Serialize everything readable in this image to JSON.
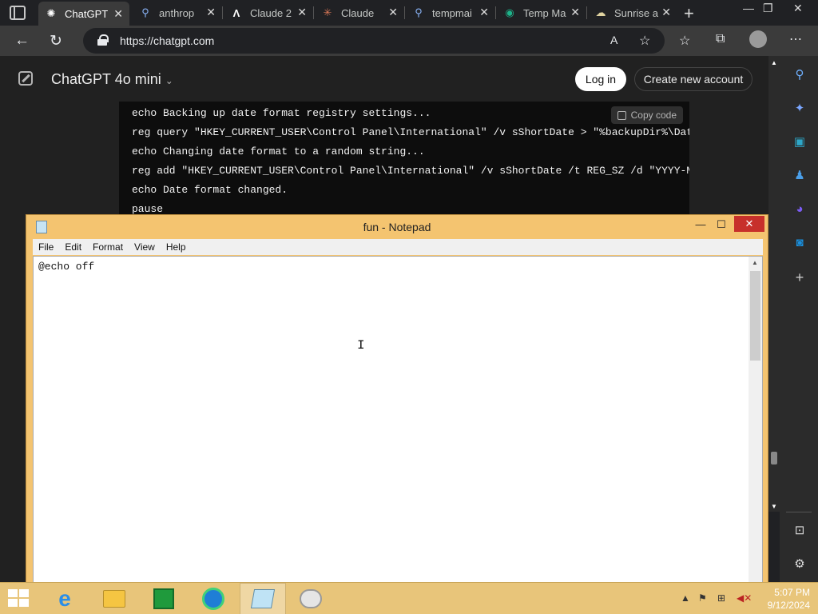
{
  "browser": {
    "tabs": [
      {
        "title": "ChatGPT",
        "favicon": "chatgpt-icon",
        "active": true
      },
      {
        "title": "anthrop",
        "favicon": "search-icon",
        "active": false
      },
      {
        "title": "Claude 2",
        "favicon": "anthropic-icon",
        "active": false
      },
      {
        "title": "Claude",
        "favicon": "claude-icon",
        "active": false
      },
      {
        "title": "tempmai",
        "favicon": "search-icon",
        "active": false
      },
      {
        "title": "Temp Ma",
        "favicon": "tempmail-icon",
        "active": false
      },
      {
        "title": "Sunrise a",
        "favicon": "sunrise-icon",
        "active": false
      }
    ],
    "url": "https://chatgpt.com"
  },
  "chat": {
    "model_title": "ChatGPT 4o mini",
    "login_label": "Log in",
    "create_account_label": "Create new account",
    "copy_code_label": "Copy code",
    "code_lines": [
      "echo Backing up date format registry settings...",
      "reg query \"HKEY_CURRENT_USER\\Control Panel\\International\" /v sShortDate > \"%backupDir%\\Date",
      "echo Changing date format to a random string...",
      "reg add \"HKEY_CURRENT_USER\\Control Panel\\International\" /v sShortDate /t REG_SZ /d \"YYYY-MM",
      "echo Date format changed.",
      "pause"
    ]
  },
  "notepad": {
    "title": "fun - Notepad",
    "menus": [
      "File",
      "Edit",
      "Format",
      "View",
      "Help"
    ],
    "content": "@echo off"
  },
  "taskbar": {
    "time": "5:07 PM",
    "date": "9/12/2024"
  },
  "colors": {
    "browser_bg": "#202124",
    "page_bg": "#212121",
    "code_bg": "#0d0d0d",
    "notepad_frame": "#f4c470",
    "taskbar": "#e8c57a",
    "close_red": "#c7302b"
  }
}
